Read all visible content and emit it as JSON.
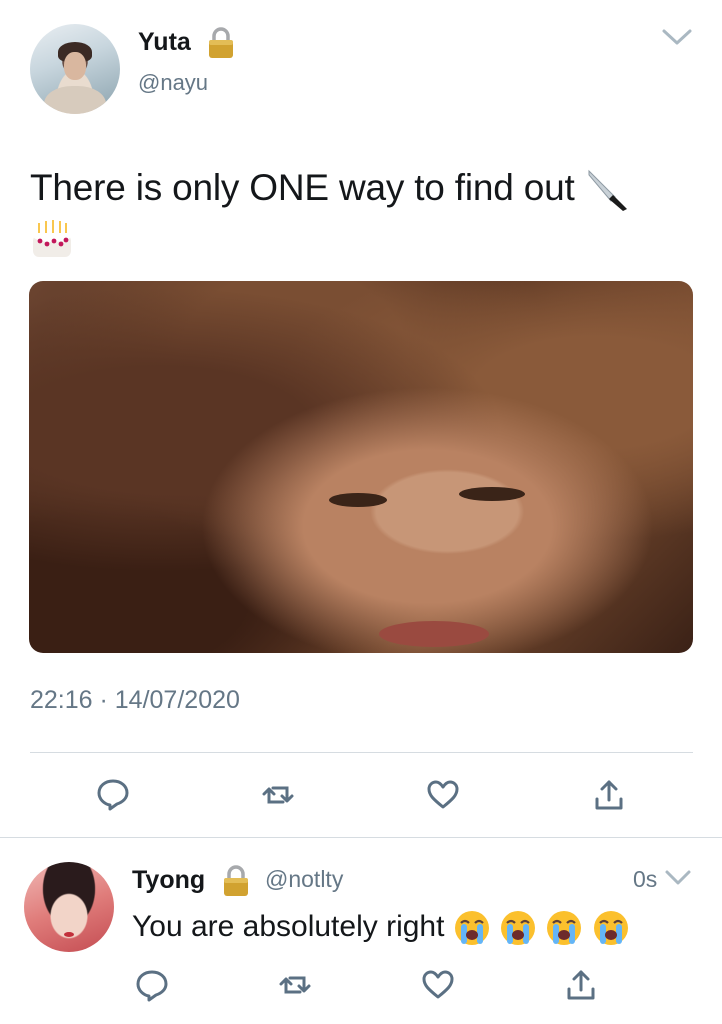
{
  "main_tweet": {
    "display_name": "Yuta",
    "handle": "@nayu",
    "text": "There is only ONE way to find out",
    "emojis": [
      "kitchen-knife-emoji",
      "birthday-cake-emoji"
    ],
    "timestamp": "22:16 · 14/07/2020",
    "actions": [
      "reply",
      "retweet",
      "like",
      "share"
    ]
  },
  "reply_tweet": {
    "display_name": "Tyong",
    "handle": "@notlty",
    "time": "0s",
    "text": "You are absolutely right",
    "emojis": [
      "loudly-crying-face-emoji",
      "loudly-crying-face-emoji",
      "loudly-crying-face-emoji",
      "loudly-crying-face-emoji"
    ],
    "actions": [
      "reply",
      "retweet",
      "like",
      "share"
    ]
  },
  "colors": {
    "text_primary": "#14171a",
    "text_secondary": "#657786",
    "icon": "#5b7083",
    "divider": "#d6dce1",
    "lock_gold": "#d1a230"
  }
}
